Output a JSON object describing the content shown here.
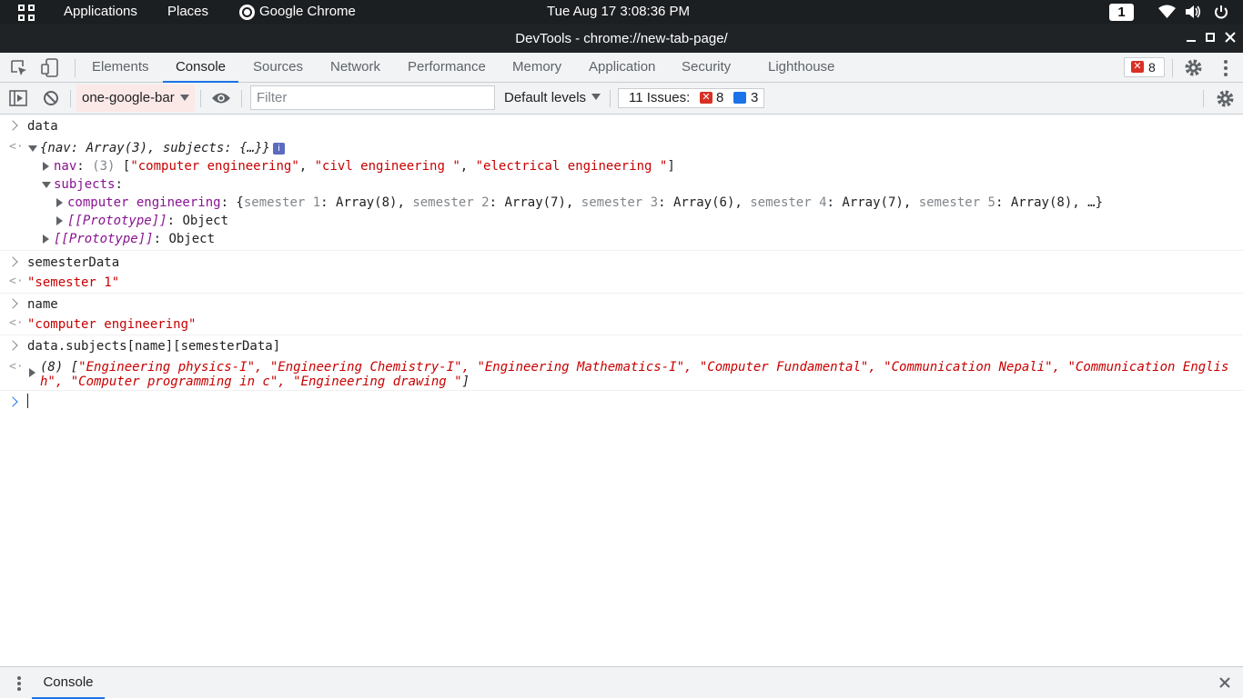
{
  "topbar": {
    "applications": "Applications",
    "places": "Places",
    "app_name": "Google Chrome",
    "datetime": "Tue Aug 17   3:08:36 PM",
    "workspace": "1"
  },
  "window": {
    "title": "DevTools - chrome://new-tab-page/"
  },
  "devtools": {
    "tabs": [
      "Elements",
      "Console",
      "Sources",
      "Network",
      "Performance",
      "Memory",
      "Application",
      "Security",
      "Lighthouse"
    ],
    "active_tab": "Console",
    "error_count": "8"
  },
  "console_toolbar": {
    "context": "one-google-bar",
    "filter_placeholder": "Filter",
    "levels": "Default levels",
    "issues_label": "11 Issues:",
    "issues_errors": "8",
    "issues_info": "3"
  },
  "console": {
    "in1": "data",
    "out1_head": "{nav: Array(3), subjects: {…}}",
    "out1_info": "i",
    "nav_key": "nav",
    "nav_count": "(3)",
    "nav_values": [
      "\"computer engineering\"",
      "\"civl engineering \"",
      "\"electrical engineering \""
    ],
    "subjects_key": "subjects",
    "ce_key": "computer engineering",
    "ce_preview": [
      {
        "k": "semester 1",
        "v": "Array(8)"
      },
      {
        "k": "semester 2",
        "v": "Array(7)"
      },
      {
        "k": "semester 3",
        "v": "Array(6)"
      },
      {
        "k": "semester 4",
        "v": "Array(7)"
      },
      {
        "k": "semester 5",
        "v": "Array(8)"
      }
    ],
    "ce_more": "…}",
    "proto": "[[Prototype]]",
    "proto_val": "Object",
    "in2": "semesterData",
    "out2": "\"semester 1\"",
    "in3": "name",
    "out3": "\"computer engineering\"",
    "in4": "data.subjects[name][semesterData]",
    "out4_count": "(8)",
    "out4_line1": "\"Engineering physics-I\", \"Engineering Chemistry-I\", \"Engineering Mathematics-I\", \"Computer Fundamental\", \"Communication Nepali\", \"Communication Englis",
    "out4_line2": "h\", \"Computer programming in c\", \"Engineering drawing \""
  },
  "drawer": {
    "tab": "Console"
  }
}
